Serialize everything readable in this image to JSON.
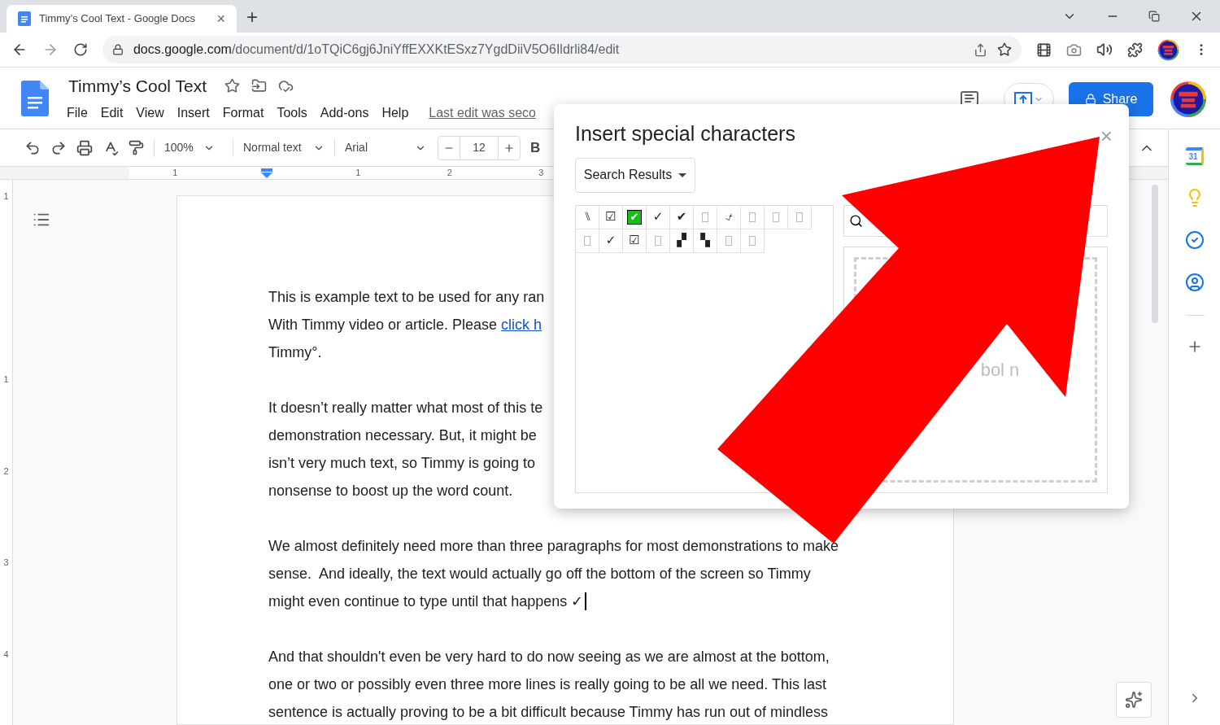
{
  "browser": {
    "tab": {
      "title": "Timmy’s Cool Text - Google Docs",
      "close": "×"
    },
    "new_tab": "+",
    "url": {
      "host": "docs.google.com",
      "path": "/document/d/1oTQiC6gj6JniYffEXXKtESxz7YgdDiiV5O6Ildrli84/edit"
    }
  },
  "docs": {
    "title": "Timmy’s Cool Text",
    "menu": [
      "File",
      "Edit",
      "View",
      "Insert",
      "Format",
      "Tools",
      "Add-ons",
      "Help"
    ],
    "last_edit": "Last edit was seco",
    "share": "Share"
  },
  "toolbar": {
    "zoom": "100%",
    "style": "Normal text",
    "font": "Arial",
    "size": "12",
    "bold": "B"
  },
  "ruler": {
    "horizontal": [
      "1",
      "1",
      "2",
      "3"
    ],
    "vertical": [
      "1",
      "1",
      "2",
      "3",
      "4"
    ]
  },
  "document": {
    "paragraphs": [
      {
        "lines": [
          {
            "text": "This is example text to be used for any ran"
          },
          {
            "text": "With Timmy video or article. Please ",
            "link": "click h"
          },
          {
            "text": "Timmy°."
          }
        ]
      },
      {
        "lines": [
          {
            "text": "It doesn’t really matter what most of this te"
          },
          {
            "text": "demonstration necessary. But, it might be"
          },
          {
            "text": "isn’t very much text, so Timmy is going to"
          },
          {
            "text": "nonsense to boost up the word count."
          }
        ]
      },
      {
        "lines": [
          {
            "text": "We almost definitely need more than three paragraphs for most demonstrations to make"
          },
          {
            "text": "sense.  And ideally, the text would actually go off the bottom of the screen so Timmy"
          },
          {
            "text": "might even continue to type until that happens ✓",
            "cursor": true
          }
        ]
      },
      {
        "lines": [
          {
            "text": "And that shouldn't even be very hard to do now seeing as we are almost at the bottom,"
          },
          {
            "text": "one or two or possibly even three more lines is really going to be all we need. This last"
          },
          {
            "text": "sentence is actually proving to be a bit difficult because Timmy has run out of mindless"
          }
        ]
      }
    ]
  },
  "dialog": {
    "title": "Insert special characters",
    "close": "×",
    "category": "Search Results",
    "characters": [
      [
        {
          "kind": "glyph",
          "char": "⑊"
        },
        {
          "kind": "glyph",
          "char": "☑"
        },
        {
          "kind": "highlight",
          "char": "✔"
        },
        {
          "kind": "glyph",
          "char": "✓"
        },
        {
          "kind": "glyph",
          "char": "✔"
        },
        {
          "kind": "missing"
        },
        {
          "kind": "glyph",
          "char": "⍻"
        },
        {
          "kind": "missing"
        },
        {
          "kind": "missing"
        },
        {
          "kind": "missing"
        }
      ],
      [
        {
          "kind": "missing"
        },
        {
          "kind": "glyph",
          "char": "✓"
        },
        {
          "kind": "glyph",
          "char": "☑"
        },
        {
          "kind": "missing"
        },
        {
          "kind": "glyph",
          "char": "▞"
        },
        {
          "kind": "glyph",
          "char": "▚"
        },
        {
          "kind": "missing"
        },
        {
          "kind": "missing"
        }
      ]
    ],
    "preview_text": "bol n"
  },
  "side_panel": {
    "calendar_day": "31"
  }
}
